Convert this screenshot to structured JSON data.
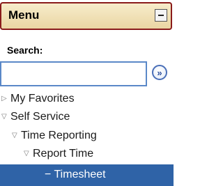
{
  "menu": {
    "title": "Menu",
    "collapse_icon": "minus-icon"
  },
  "search": {
    "label": "Search:",
    "value": "",
    "placeholder": "",
    "go_icon": "double-chevron-right-icon",
    "go_glyph": "»"
  },
  "nav": {
    "items": [
      {
        "label": "My Favorites",
        "arrow": "▷",
        "expanded": false
      },
      {
        "label": "Self Service",
        "arrow": "▽",
        "expanded": true
      },
      {
        "label": "Time Reporting",
        "arrow": "▽",
        "expanded": true
      },
      {
        "label": "Report Time",
        "arrow": "▽",
        "expanded": true
      },
      {
        "label": "− Timesheet",
        "selected": true
      }
    ]
  },
  "colors": {
    "header_border": "#8a1b1b",
    "header_bg": "#ead6a3",
    "selected_bg": "#2f63a7",
    "input_border": "#5a88c8"
  }
}
